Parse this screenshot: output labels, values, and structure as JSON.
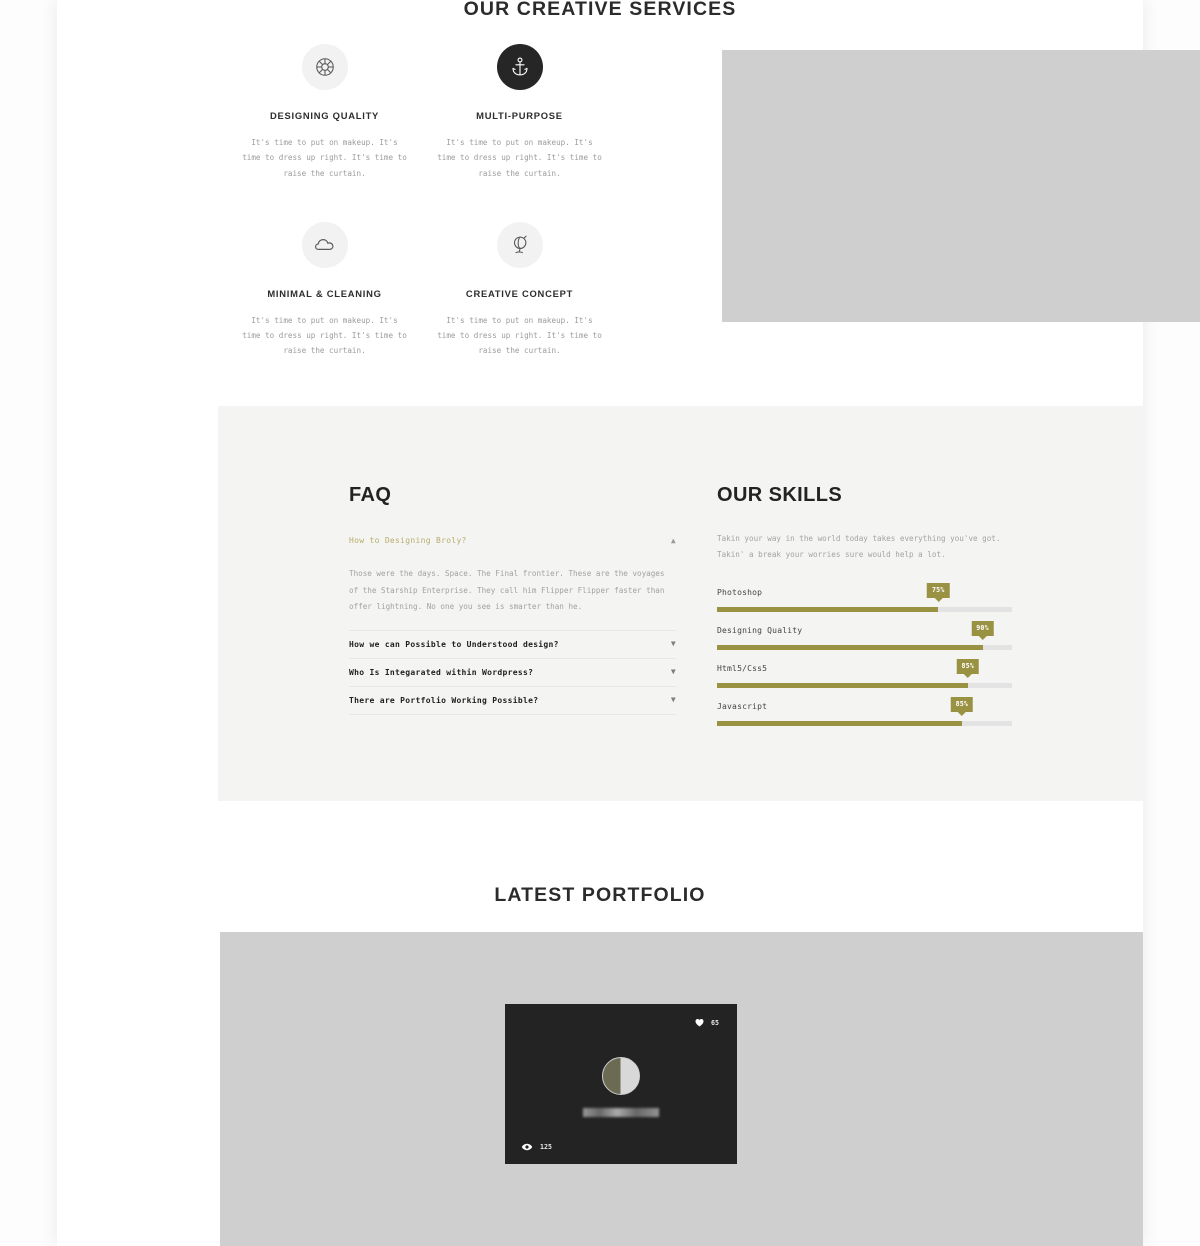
{
  "services": {
    "title": "OUR CREATIVE SERVICES",
    "items": [
      {
        "icon": "lifebuoy-icon",
        "name": "DESIGNING QUALITY",
        "desc": "It's time to put on makeup. It's time to dress up right. It's time to raise the curtain."
      },
      {
        "icon": "anchor-icon",
        "name": "MULTI-PURPOSE",
        "desc": "It's time to put on makeup. It's time to dress up right. It's time to raise the curtain."
      },
      {
        "icon": "cloud-icon",
        "name": "MINIMAL & CLEANING",
        "desc": "It's time to put on makeup. It's time to dress up right. It's time to raise the curtain."
      },
      {
        "icon": "globe-icon",
        "name": "CREATIVE CONCEPT",
        "desc": "It's time to put on makeup. It's time to dress up right. It's time to raise the curtain."
      }
    ]
  },
  "faq": {
    "heading": "FAQ",
    "items": [
      {
        "question": "How to Designing Broly?",
        "answer": "Those were the days. Space. The Final frontier. These are the voyages of the Starship Enterprise. They call him Flipper Flipper faster than offer lightning. No one you see is smarter than he.",
        "expanded": true,
        "chevron": "chevron-up-icon"
      },
      {
        "question": "How we can Possible to Understood design?",
        "answer": "",
        "expanded": false,
        "chevron": "chevron-down-icon"
      },
      {
        "question": "Who Is Integarated within Wordpress?",
        "answer": "",
        "expanded": false,
        "chevron": "chevron-down-icon"
      },
      {
        "question": "There are Portfolio Working Possible?",
        "answer": "",
        "expanded": false,
        "chevron": "chevron-down-icon"
      }
    ]
  },
  "skills": {
    "heading": "OUR SKILLS",
    "description": "Takin your way in the world today takes everything you've got. Takin' a break your worries sure would help a lot.",
    "items": [
      {
        "label": "Photoshop",
        "value": 75,
        "badge": "75%"
      },
      {
        "label": "Designing Quality",
        "value": 90,
        "badge": "90%"
      },
      {
        "label": "Html5/Css5",
        "value": 85,
        "badge": "85%"
      },
      {
        "label": "Javascript",
        "value": 85,
        "badge": "85%"
      }
    ]
  },
  "portfolio": {
    "title": "LATEST PORTFOLIO",
    "card": {
      "likes": "65",
      "views": "125",
      "like_icon": "heart-icon",
      "view_icon": "eye-icon"
    }
  },
  "colors": {
    "accent": "#9a9243",
    "accent_light": "#b8ad6a",
    "dark": "#232323",
    "panel_bg": "#f4f4f3",
    "placeholder_gray": "#cfcfcf",
    "track_gray": "#e3e3e3"
  }
}
